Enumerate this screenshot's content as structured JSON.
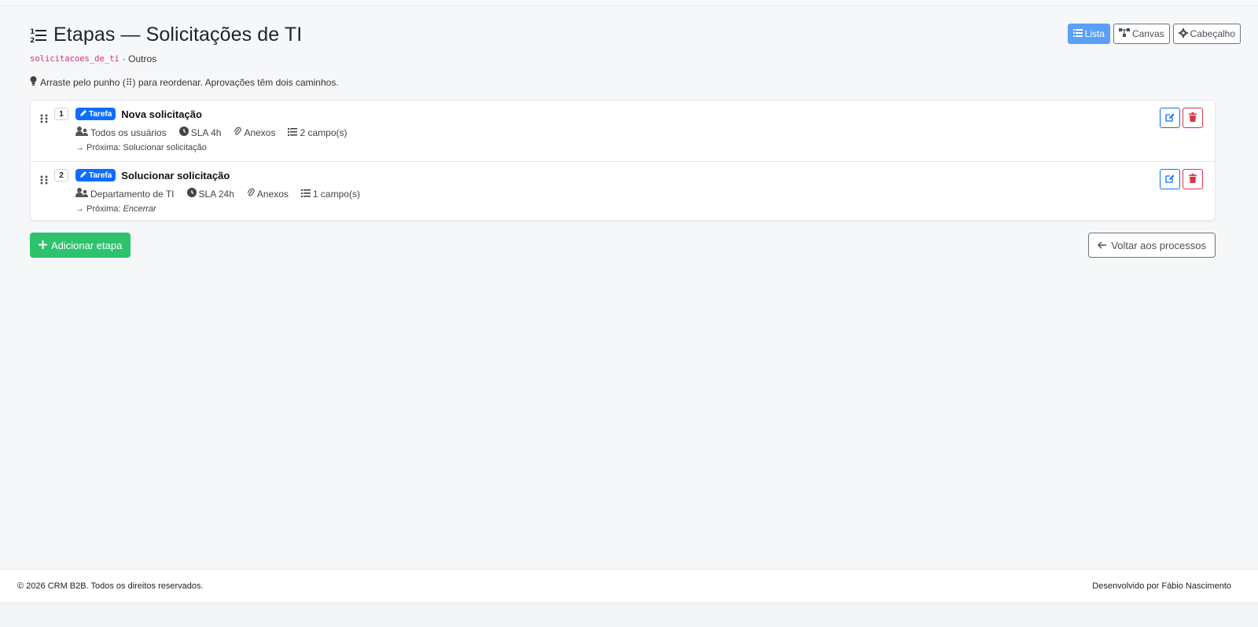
{
  "page": {
    "title": "Etapas — Solicitações de TI",
    "slug": "solicitacoes_de_ti",
    "category": "· Outros",
    "hint": "Arraste pelo punho (⠿) para reordenar. Aprovações têm dois caminhos."
  },
  "view_toggle": {
    "list_label": "Lista",
    "canvas_label": "Canvas",
    "header_label": "Cabeçalho",
    "active": "Lista"
  },
  "steps": [
    {
      "number": "1",
      "badge": "Tarefa",
      "name": "Nova solicitação",
      "assignee": "Todos os usuários",
      "sla": "SLA 4h",
      "attachments": "Anexos",
      "fields": "2 campo(s)",
      "next_prefix": "→ Próxima: ",
      "next_value": "Solucionar solicitação"
    },
    {
      "number": "2",
      "badge": "Tarefa",
      "name": "Solucionar solicitação",
      "assignee": "Departamento de TI",
      "sla": "SLA 24h",
      "attachments": "Anexos",
      "fields": "1 campo(s)",
      "next_prefix": "→ Próxima: ",
      "next_value": "Encerrar"
    }
  ],
  "actions": {
    "add_label": "Adicionar etapa",
    "back_label": "Voltar aos processos"
  },
  "footer": {
    "copyright": "© 2026 CRM B2B. Todos os direitos reservados.",
    "credit": "Desenvolvido por Fábio Nascimento"
  },
  "colors": {
    "primary": "#0d6efd",
    "active_toggle": "#5aa0f8",
    "success": "#2ec26e",
    "danger": "#dc3545",
    "slug": "#d63384"
  },
  "icons": [
    "list-ordered-icon",
    "list-icon",
    "diagram-icon",
    "gear-icon",
    "lightbulb-icon",
    "drag-handle-icon",
    "pencil-icon",
    "users-icon",
    "clock-icon",
    "paperclip-icon",
    "edit-icon",
    "trash-icon",
    "plus-icon",
    "arrow-left-icon"
  ]
}
